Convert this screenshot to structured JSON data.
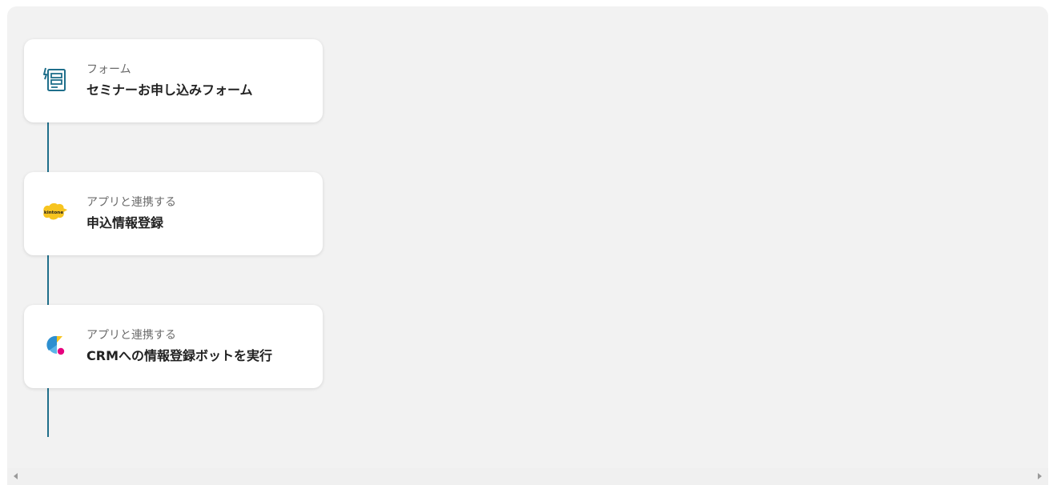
{
  "flow": {
    "steps": [
      {
        "subtitle": "フォーム",
        "title": "セミナーお申し込みフォーム",
        "icon": "form-icon"
      },
      {
        "subtitle": "アプリと連携する",
        "title": "申込情報登録",
        "icon": "kintone-icon",
        "icon_text": "kintone"
      },
      {
        "subtitle": "アプリと連携する",
        "title": "CRMへの情報登録ボットを実行",
        "icon": "robot-app-icon"
      }
    ]
  },
  "colors": {
    "connector": "#1f6f8b",
    "canvas": "#f2f2f2",
    "kintone_yellow": "#f7c41f",
    "robot_blue": "#5bb5e8",
    "robot_pink": "#e6007e"
  },
  "scrollbar": {
    "left_icon": "scroll-left-arrow-icon",
    "right_icon": "scroll-right-arrow-icon"
  }
}
